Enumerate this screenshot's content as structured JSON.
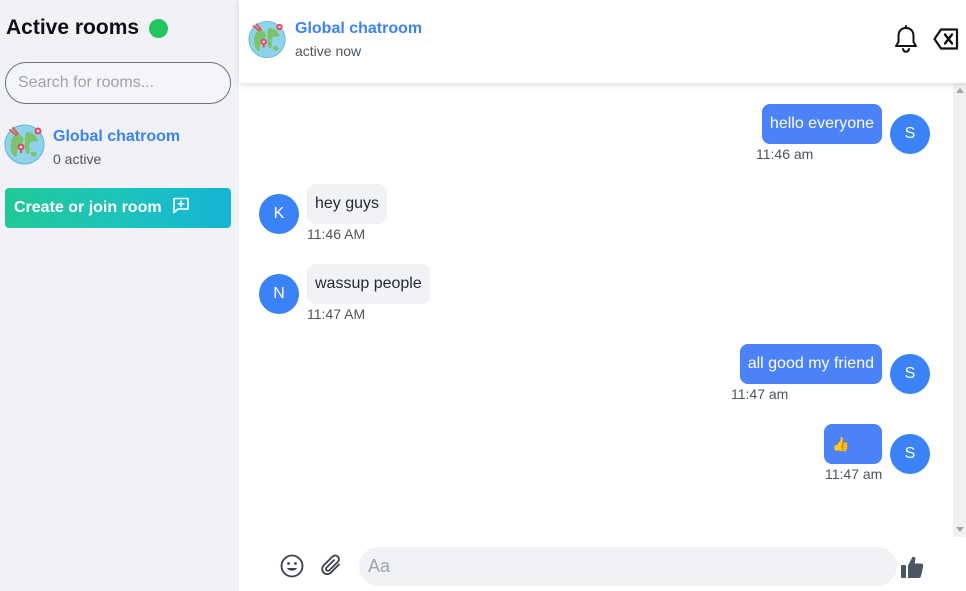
{
  "sidebar": {
    "title": "Active rooms",
    "online_color": "#22c55e",
    "search_placeholder": "Search for rooms...",
    "rooms": [
      {
        "name": "Global chatroom",
        "subtitle": "0 active",
        "icon": "globe-icon"
      }
    ],
    "create_button": {
      "label": "Create or join room",
      "icon": "add-chat-icon"
    }
  },
  "header": {
    "room_name": "Global chatroom",
    "status": "active now",
    "icons": [
      "globe-icon",
      "bell-icon",
      "backspace-close-icon"
    ]
  },
  "messages": [
    {
      "author": "S",
      "text": "hello everyone",
      "time": "11:46 am",
      "outgoing": true
    },
    {
      "author": "K",
      "text": "hey guys",
      "time": "11:46 AM",
      "outgoing": false
    },
    {
      "author": "N",
      "text": "wassup people",
      "time": "11:47 AM",
      "outgoing": false
    },
    {
      "author": "S",
      "text": "all good my friend",
      "time": "11:47 am",
      "outgoing": true
    },
    {
      "author": "S",
      "text": "👍",
      "time": "11:47 am",
      "outgoing": true
    }
  ],
  "composer": {
    "placeholder": "Aa",
    "icons": [
      "emoji-icon",
      "paperclip-icon",
      "thumbs-up-icon"
    ]
  },
  "colors": {
    "accent": "#3b82f6",
    "outgoing_bubble": "#4b82f7",
    "incoming_bubble": "#f1f2f6",
    "sidebar_bg": "#f0f2f7",
    "create_gradient_start": "#20c997",
    "create_gradient_end": "#15b4d6"
  }
}
